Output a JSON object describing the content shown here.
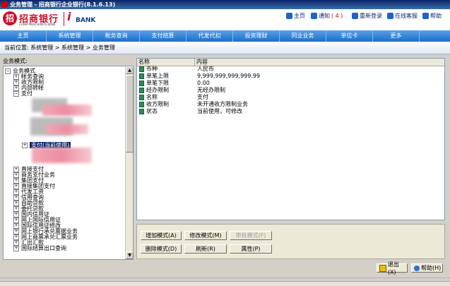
{
  "window": {
    "title": "业务管理 - 招商银行企业银行(8.1.6.13)"
  },
  "brand": {
    "mark": "招",
    "name": "招商银行",
    "sub": "CHINA MERCHANTS BANK",
    "ubank_u": "i",
    "ubank_text": "BANK"
  },
  "header_links": [
    {
      "label": "主页",
      "icon": "home-icon",
      "color": "#1f62c9"
    },
    {
      "label": "通知",
      "count": "( 4 )",
      "icon": "notice-icon",
      "color": "#1f62c9"
    },
    {
      "label": "重新登录",
      "icon": "relogin-icon",
      "color": "#1f62c9"
    },
    {
      "label": "在线客服",
      "icon": "service-icon",
      "color": "#1f62c9"
    },
    {
      "label": "帮助",
      "icon": "help-icon",
      "color": "#1f62c9"
    }
  ],
  "nav": [
    "主页",
    "系统管理",
    "帐务查询",
    "支付结算",
    "代发代扣",
    "投资理财",
    "同业业务",
    "单位卡",
    "更多"
  ],
  "breadcrumb": "当前位置: 系统管理 > 系统管理 > 业务管理",
  "left": {
    "label": "业务模式:",
    "tree": [
      {
        "label": "业务模式",
        "box": "−",
        "level": 0
      },
      {
        "label": "帐务查询",
        "box": "+",
        "level": 1
      },
      {
        "label": "收方限制",
        "box": "+",
        "level": 1
      },
      {
        "label": "内部转帐",
        "box": "+",
        "level": 1
      },
      {
        "label": "支付",
        "box": "−",
        "level": 1
      },
      {
        "label": "支付(当前使用)",
        "box": "+",
        "level": 2,
        "selected": true
      },
      {
        "label": "直接支付",
        "box": "+",
        "level": 1
      },
      {
        "label": "商务支付业务",
        "box": "+",
        "level": 1
      },
      {
        "label": "集团支付",
        "box": "+",
        "level": 1
      },
      {
        "label": "直接集团支付",
        "box": "+",
        "level": 1
      },
      {
        "label": "代发工资",
        "box": "+",
        "level": 1
      },
      {
        "label": "信用查询",
        "box": "+",
        "level": 1
      },
      {
        "label": "自助贷款",
        "box": "+",
        "level": 1
      },
      {
        "label": "委托贷款",
        "box": "+",
        "level": 1
      },
      {
        "label": "国内信用证",
        "box": "+",
        "level": 1
      },
      {
        "label": "网上国际信用证",
        "box": "+",
        "level": 1
      },
      {
        "label": "国际信用证修改",
        "box": "+",
        "level": 1
      },
      {
        "label": "网上银行承兑票据业务",
        "box": "+",
        "level": 1
      },
      {
        "label": "网上商票承兑汇票业务",
        "box": "+",
        "level": 1
      },
      {
        "label": "汇出汇款",
        "box": "+",
        "level": 1
      },
      {
        "label": "国际结算出口查询",
        "box": "+",
        "level": 1
      }
    ]
  },
  "grid": {
    "headers": [
      "名称",
      "内容"
    ],
    "rows": [
      {
        "name": "币种",
        "value": "人民币"
      },
      {
        "name": "单笔上限",
        "value": "9,999,999,999,999.99"
      },
      {
        "name": "单笔下限",
        "value": "0.00"
      },
      {
        "name": "经办限制",
        "value": "无经办限制"
      },
      {
        "name": "名称",
        "value": "支付"
      },
      {
        "name": "收方限制",
        "value": "未开通收方限制业务"
      },
      {
        "name": "状态",
        "value": "当前使用，可修改"
      }
    ]
  },
  "buttons": {
    "add": "增加模式(A)",
    "modify": "修改模式(M)",
    "approve": "审批模式(F)",
    "delete": "删除模式(D)",
    "refresh": "刷新(R)",
    "props": "属性(P)"
  },
  "footer": {
    "exit": "退出(X)",
    "help": "帮助(H)"
  }
}
